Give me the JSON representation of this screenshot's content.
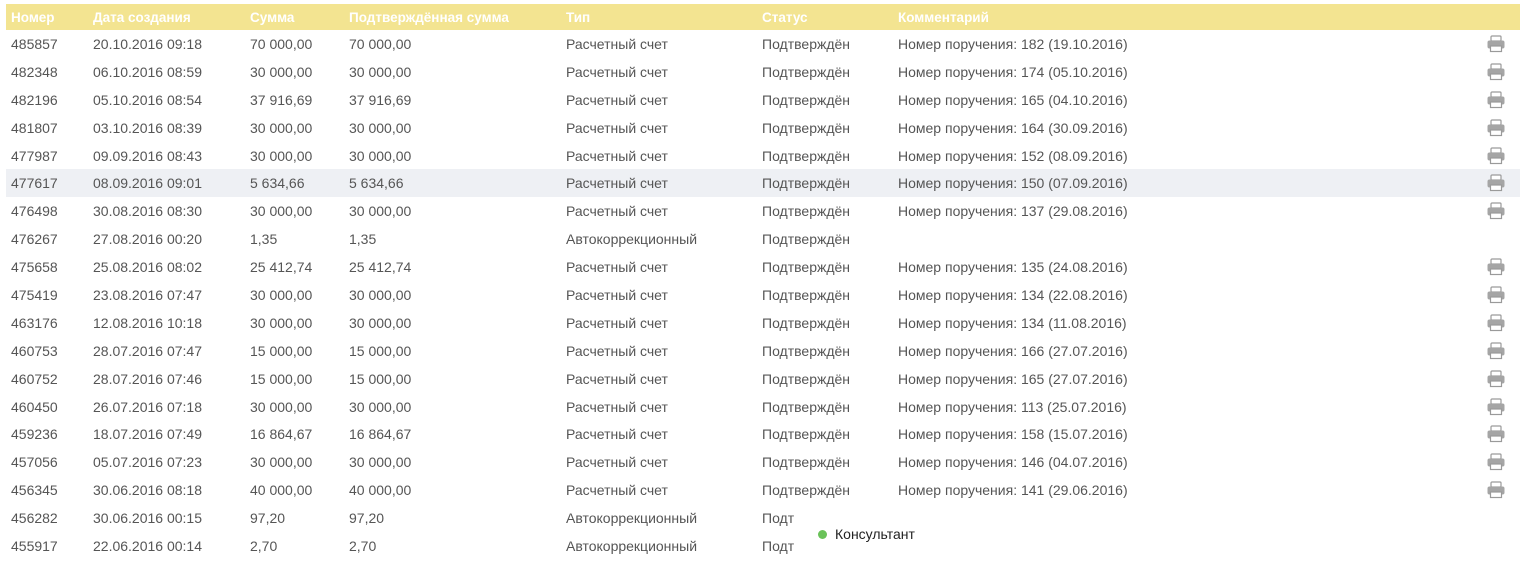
{
  "table": {
    "columns": [
      "Номер",
      "Дата создания",
      "Сумма",
      "Подтверждённая сумма",
      "Тип",
      "Статус",
      "Комментарий"
    ],
    "rows": [
      {
        "num": "485857",
        "date": "20.10.2016 09:18",
        "sum": "70 000,00",
        "confirmed": "70 000,00",
        "type": "Расчетный счет",
        "status": "Подтверждён",
        "comment": "Номер поручения: 182 (19.10.2016)",
        "print": true
      },
      {
        "num": "482348",
        "date": "06.10.2016 08:59",
        "sum": "30 000,00",
        "confirmed": "30 000,00",
        "type": "Расчетный счет",
        "status": "Подтверждён",
        "comment": "Номер поручения: 174 (05.10.2016)",
        "print": true
      },
      {
        "num": "482196",
        "date": "05.10.2016 08:54",
        "sum": "37 916,69",
        "confirmed": "37 916,69",
        "type": "Расчетный счет",
        "status": "Подтверждён",
        "comment": "Номер поручения: 165 (04.10.2016)",
        "print": true
      },
      {
        "num": "481807",
        "date": "03.10.2016 08:39",
        "sum": "30 000,00",
        "confirmed": "30 000,00",
        "type": "Расчетный счет",
        "status": "Подтверждён",
        "comment": "Номер поручения: 164 (30.09.2016)",
        "print": true
      },
      {
        "num": "477987",
        "date": "09.09.2016 08:43",
        "sum": "30 000,00",
        "confirmed": "30 000,00",
        "type": "Расчетный счет",
        "status": "Подтверждён",
        "comment": "Номер поручения: 152 (08.09.2016)",
        "print": true
      },
      {
        "num": "477617",
        "date": "08.09.2016 09:01",
        "sum": "5 634,66",
        "confirmed": "5 634,66",
        "type": "Расчетный счет",
        "status": "Подтверждён",
        "comment": "Номер поручения: 150 (07.09.2016)",
        "print": true,
        "highlight": true
      },
      {
        "num": "476498",
        "date": "30.08.2016 08:30",
        "sum": "30 000,00",
        "confirmed": "30 000,00",
        "type": "Расчетный счет",
        "status": "Подтверждён",
        "comment": "Номер поручения: 137 (29.08.2016)",
        "print": true
      },
      {
        "num": "476267",
        "date": "27.08.2016 00:20",
        "sum": "1,35",
        "confirmed": "1,35",
        "type": "Автокоррекционный",
        "status": "Подтверждён",
        "comment": "",
        "print": false
      },
      {
        "num": "475658",
        "date": "25.08.2016 08:02",
        "sum": "25 412,74",
        "confirmed": "25 412,74",
        "type": "Расчетный счет",
        "status": "Подтверждён",
        "comment": "Номер поручения: 135 (24.08.2016)",
        "print": true
      },
      {
        "num": "475419",
        "date": "23.08.2016 07:47",
        "sum": "30 000,00",
        "confirmed": "30 000,00",
        "type": "Расчетный счет",
        "status": "Подтверждён",
        "comment": "Номер поручения: 134 (22.08.2016)",
        "print": true
      },
      {
        "num": "463176",
        "date": "12.08.2016 10:18",
        "sum": "30 000,00",
        "confirmed": "30 000,00",
        "type": "Расчетный счет",
        "status": "Подтверждён",
        "comment": "Номер поручения: 134 (11.08.2016)",
        "print": true
      },
      {
        "num": "460753",
        "date": "28.07.2016 07:47",
        "sum": "15 000,00",
        "confirmed": "15 000,00",
        "type": "Расчетный счет",
        "status": "Подтверждён",
        "comment": "Номер поручения: 166 (27.07.2016)",
        "print": true
      },
      {
        "num": "460752",
        "date": "28.07.2016 07:46",
        "sum": "15 000,00",
        "confirmed": "15 000,00",
        "type": "Расчетный счет",
        "status": "Подтверждён",
        "comment": "Номер поручения: 165 (27.07.2016)",
        "print": true
      },
      {
        "num": "460450",
        "date": "26.07.2016 07:18",
        "sum": "30 000,00",
        "confirmed": "30 000,00",
        "type": "Расчетный счет",
        "status": "Подтверждён",
        "comment": "Номер поручения: 113 (25.07.2016)",
        "print": true
      },
      {
        "num": "459236",
        "date": "18.07.2016 07:49",
        "sum": "16 864,67",
        "confirmed": "16 864,67",
        "type": "Расчетный счет",
        "status": "Подтверждён",
        "comment": "Номер поручения: 158 (15.07.2016)",
        "print": true
      },
      {
        "num": "457056",
        "date": "05.07.2016 07:23",
        "sum": "30 000,00",
        "confirmed": "30 000,00",
        "type": "Расчетный счет",
        "status": "Подтверждён",
        "comment": "Номер поручения: 146 (04.07.2016)",
        "print": true
      },
      {
        "num": "456345",
        "date": "30.06.2016 08:18",
        "sum": "40 000,00",
        "confirmed": "40 000,00",
        "type": "Расчетный счет",
        "status": "Подтверждён",
        "comment": "Номер поручения: 141 (29.06.2016)",
        "print": true
      },
      {
        "num": "456282",
        "date": "30.06.2016 00:15",
        "sum": "97,20",
        "confirmed": "97,20",
        "type": "Автокоррекционный",
        "status": "Подт",
        "comment": "",
        "print": false
      },
      {
        "num": "455917",
        "date": "22.06.2016 00:14",
        "sum": "2,70",
        "confirmed": "2,70",
        "type": "Автокоррекционный",
        "status": "Подт",
        "comment": "",
        "print": false
      }
    ]
  },
  "consultant": {
    "label": "Консультант",
    "status_color": "#6ac259"
  },
  "colors": {
    "header_bg": "#f3e491",
    "row_highlight": "#eef0f4",
    "text": "#555555"
  }
}
